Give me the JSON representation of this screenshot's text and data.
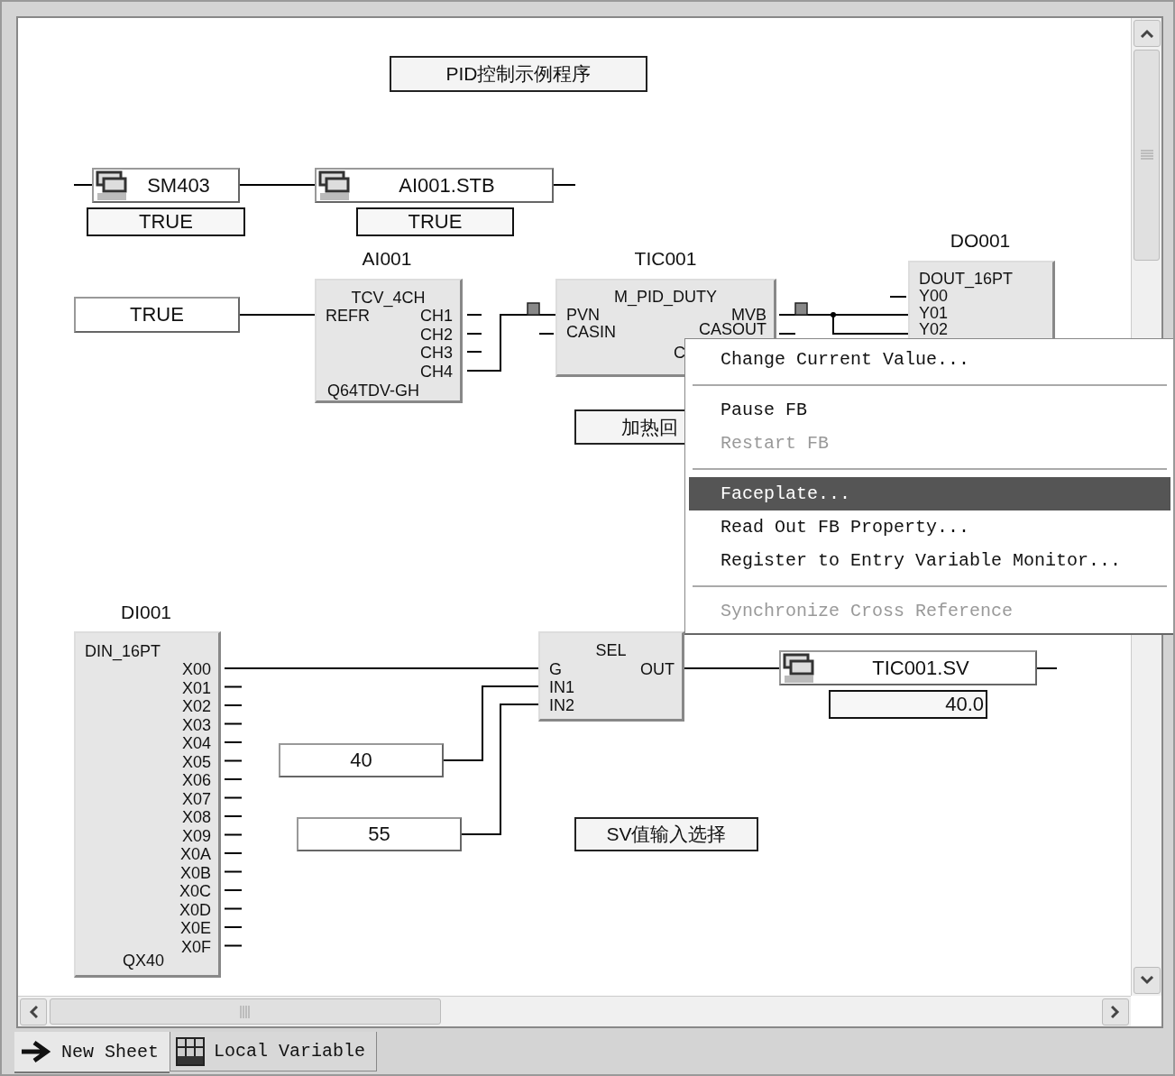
{
  "comments": [
    {
      "text": "PID控制示例程序"
    },
    {
      "text": "加热回"
    },
    {
      "text": "SV值输入选择"
    }
  ],
  "variables": [
    {
      "name": "SM403",
      "value": "TRUE"
    },
    {
      "name": "AI001.STB",
      "value": "TRUE"
    },
    {
      "name": "TIC001.SV",
      "value": "40.0"
    }
  ],
  "constants": [
    "TRUE",
    "40",
    "55"
  ],
  "blocks": [
    {
      "instance": "AI001",
      "type": "TCV_4CH",
      "inputs": [
        "REFR"
      ],
      "outputs": [
        "CH1",
        "CH2",
        "CH3",
        "CH4"
      ],
      "footer": "Q64TDV-GH"
    },
    {
      "instance": "TIC001",
      "type": "M_PID_DUTY",
      "inputs": [
        "PVN",
        "CASIN"
      ],
      "outputs": [
        "MVB",
        "CASOUT",
        "C"
      ]
    },
    {
      "instance": "DO001",
      "type": "DOUT_16PT",
      "inputs": [
        "Y00",
        "Y01",
        "Y02"
      ]
    },
    {
      "instance": "DI001",
      "type": "DIN_16PT",
      "outputs": [
        "X00",
        "X01",
        "X02",
        "X03",
        "X04",
        "X05",
        "X06",
        "X07",
        "X08",
        "X09",
        "X0A",
        "X0B",
        "X0C",
        "X0D",
        "X0E",
        "X0F"
      ],
      "footer": "QX40"
    },
    {
      "type": "SEL",
      "inputs": [
        "G",
        "IN1",
        "IN2"
      ],
      "outputs": [
        "OUT"
      ]
    }
  ],
  "context_menu": [
    {
      "kind": "item",
      "label": "Change Current Value...",
      "disabled": false,
      "selected": false
    },
    {
      "kind": "separator"
    },
    {
      "kind": "item",
      "label": "Pause FB",
      "disabled": false,
      "selected": false
    },
    {
      "kind": "item",
      "label": "Restart FB",
      "disabled": true,
      "selected": false
    },
    {
      "kind": "separator"
    },
    {
      "kind": "item",
      "label": "Faceplate...",
      "disabled": false,
      "selected": true
    },
    {
      "kind": "item",
      "label": "Read Out FB Property...",
      "disabled": false,
      "selected": false
    },
    {
      "kind": "item",
      "label": "Register to Entry Variable Monitor...",
      "disabled": false,
      "selected": false
    },
    {
      "kind": "separator"
    },
    {
      "kind": "item",
      "label": "Synchronize Cross Reference",
      "disabled": true,
      "selected": false
    }
  ],
  "tabs": [
    {
      "label": "New Sheet",
      "kind": "sheet",
      "selected": true
    },
    {
      "label": "Local Variable",
      "kind": "variables",
      "selected": false
    }
  ]
}
